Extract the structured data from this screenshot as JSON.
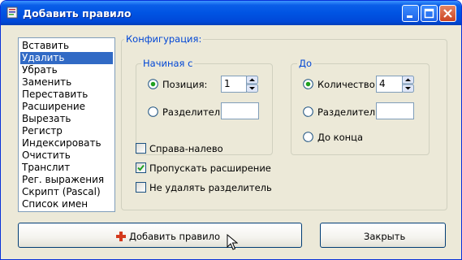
{
  "window": {
    "title": "Добавить правило"
  },
  "rules_list": {
    "items": [
      "Вставить",
      "Удалить",
      "Убрать",
      "Заменить",
      "Переставить",
      "Расширение",
      "Вырезать",
      "Регистр",
      "Индексировать",
      "Очистить",
      "Транслит",
      "Рег. выражения",
      "Скрипт (Pascal)",
      "Список имен"
    ],
    "selected": "Удалить"
  },
  "config": {
    "label": "Конфигурация:",
    "start": {
      "label": "Начиная с",
      "position_label": "Позиция:",
      "position_value": "1",
      "delimiter_label": "Разделитель:",
      "delimiter_value": ""
    },
    "to": {
      "label": "До",
      "count_label": "Количество:",
      "count_value": "4",
      "delimiter_label": "Разделитель:",
      "delimiter_value": "",
      "to_end_label": "До конца"
    },
    "rtl_label": "Справа-налево",
    "skip_ext_label": "Пропускать расширение",
    "keep_delim_label": "Не удалять разделитель"
  },
  "buttons": {
    "add_rule": "Добавить правило",
    "close": "Закрыть"
  },
  "colors": {
    "title_blue": "#0054e3",
    "group_label": "#0046d5",
    "selection": "#316ac5",
    "add_icon_red": "#d43a1e"
  }
}
